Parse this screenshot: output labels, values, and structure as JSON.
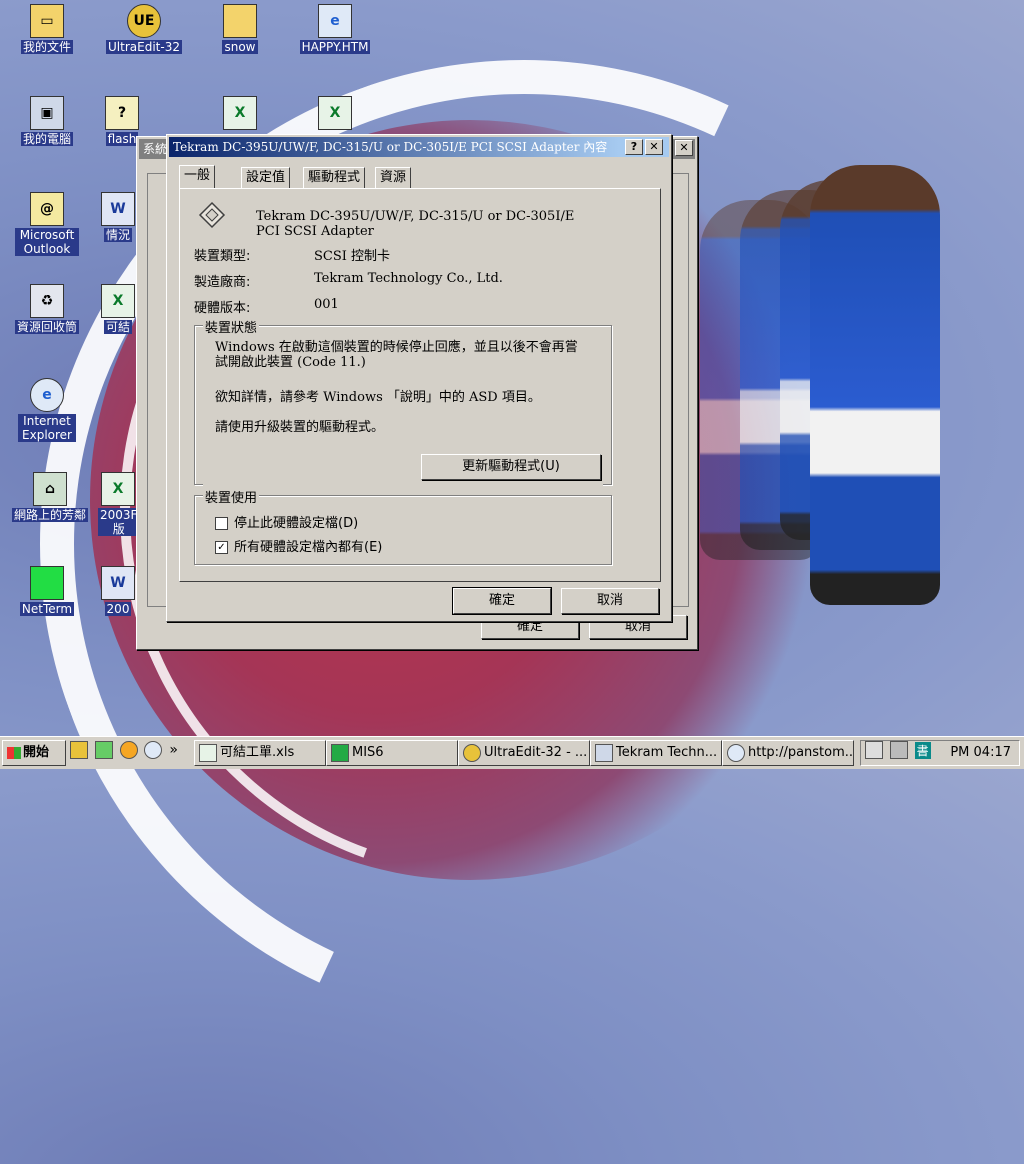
{
  "desktop": {
    "icons": [
      {
        "label": "我的文件"
      },
      {
        "label": "UltraEdit-32"
      },
      {
        "label": "snow"
      },
      {
        "label": "HAPPY.HTM"
      },
      {
        "label": "我的電腦"
      },
      {
        "label": "flash"
      },
      {
        "label": "Microsoft Outlook"
      },
      {
        "label": "情況"
      },
      {
        "label": "資源回收筒"
      },
      {
        "label": "可結"
      },
      {
        "label": "Internet Explorer"
      },
      {
        "label": "網路上的芳鄰"
      },
      {
        "label": "2003F 版"
      },
      {
        "label": "NetTerm"
      },
      {
        "label": "200"
      }
    ],
    "back_dialog": {
      "title": "系統",
      "ok_label": "確定",
      "cancel_label": "取消"
    }
  },
  "dialog": {
    "title": "Tekram DC-395U/UW/F, DC-315/U or DC-305I/E PCI SCSI Adapter 內容",
    "help_button": "?",
    "close_button": "✕",
    "outer_close_button": "✕",
    "tabs": [
      "一般",
      "設定值",
      "驅動程式",
      "資源"
    ],
    "device_name": "Tekram DC-395U/UW/F, DC-315/U or DC-305I/E PCI SCSI Adapter",
    "fields": [
      {
        "label": "裝置類型:",
        "value": "SCSI 控制卡"
      },
      {
        "label": "製造廠商:",
        "value": "Tekram Technology Co., Ltd."
      },
      {
        "label": "硬體版本:",
        "value": "001"
      }
    ],
    "status_group": {
      "title": "裝置狀態",
      "line1": "Windows 在啟動這個裝置的時候停止回應，並且以後不會再嘗試開啟此裝置 (Code 11.)",
      "line2": "欲知詳情，請參考 Windows 「說明」中的 ASD 項目。",
      "line3": "請使用升級裝置的驅動程式。",
      "update_driver_button": "更新驅動程式(U)"
    },
    "usage_group": {
      "title": "裝置使用",
      "options": [
        {
          "label": "停止此硬體設定檔(D)",
          "checked": false
        },
        {
          "label": "所有硬體設定檔內都有(E)",
          "checked": true
        }
      ]
    },
    "ok_label": "確定",
    "cancel_label": "取消"
  },
  "taskbar": {
    "start_label": "開始",
    "chevron": "»",
    "items": [
      {
        "label": "可結工單.xls"
      },
      {
        "label": "MIS6"
      },
      {
        "label": "UltraEdit-32 - ..."
      },
      {
        "label": "Tekram Techn..."
      },
      {
        "label": "http://panstom...."
      }
    ],
    "clock": "PM 04:17",
    "ime_label": "書"
  }
}
